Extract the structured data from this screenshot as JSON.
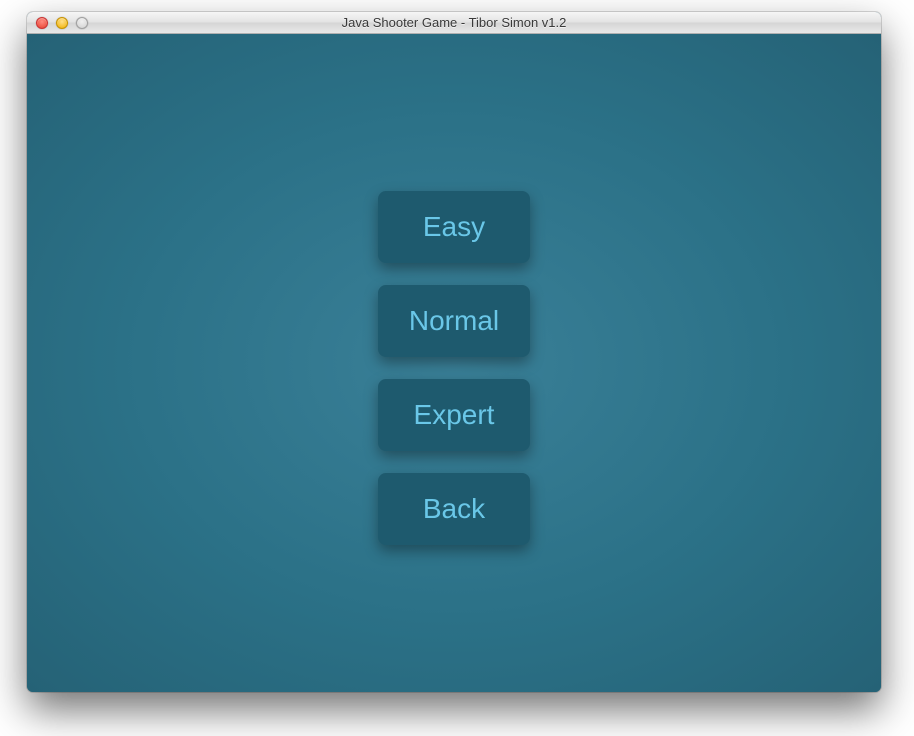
{
  "window": {
    "title": "Java Shooter Game - Tibor Simon v1.2"
  },
  "menu": {
    "easy_label": "Easy",
    "normal_label": "Normal",
    "expert_label": "Expert",
    "back_label": "Back"
  },
  "colors": {
    "background": "#2b7187",
    "button_bg": "#1e5a6e",
    "button_text": "#6ac7e8"
  }
}
